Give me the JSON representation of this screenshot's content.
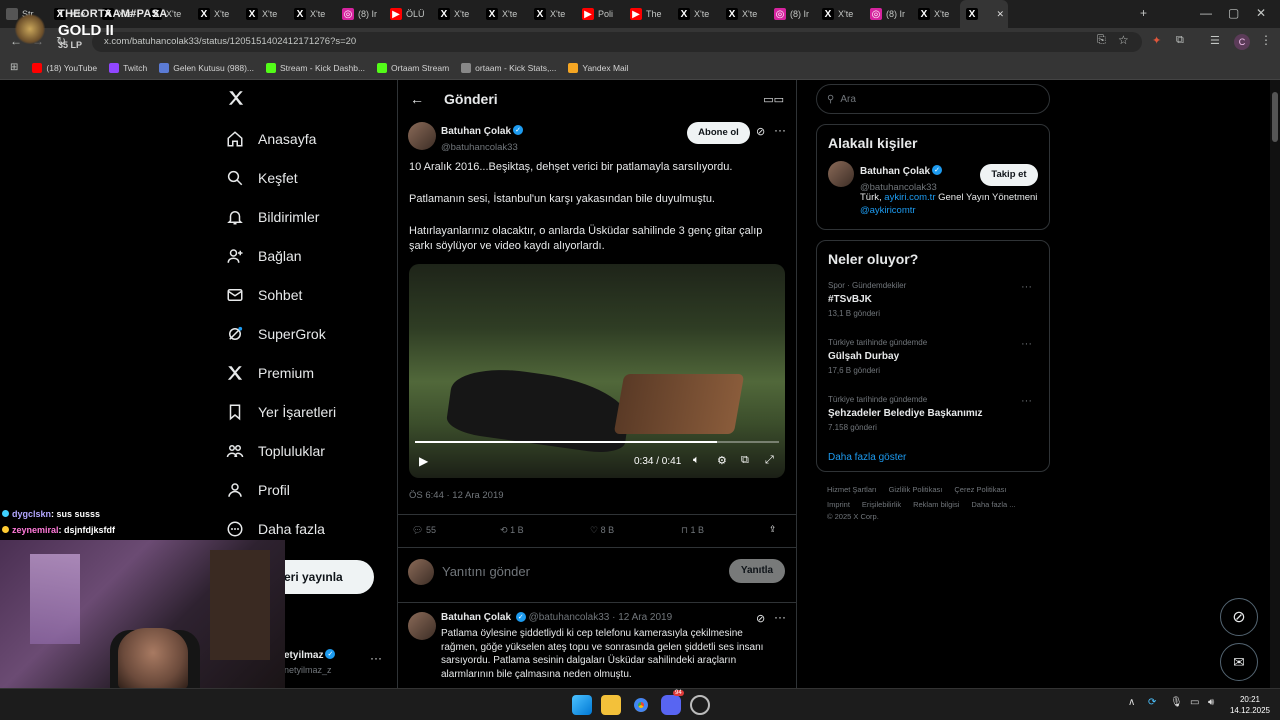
{
  "browser": {
    "tabs": [
      {
        "label": "Str",
        "icon": "blank"
      },
      {
        "label": "X'te",
        "icon": "x"
      },
      {
        "label": "X'te",
        "icon": "x"
      },
      {
        "label": "X'te",
        "icon": "x"
      },
      {
        "label": "X'te",
        "icon": "x"
      },
      {
        "label": "X'te",
        "icon": "x"
      },
      {
        "label": "X'te",
        "icon": "x"
      },
      {
        "label": "(8) Ir",
        "icon": "instagram"
      },
      {
        "label": "ÖLÜ",
        "icon": "youtube"
      },
      {
        "label": "X'te",
        "icon": "x"
      },
      {
        "label": "X'te",
        "icon": "x"
      },
      {
        "label": "X'te",
        "icon": "x"
      },
      {
        "label": "Poli",
        "icon": "youtube"
      },
      {
        "label": "The",
        "icon": "youtube"
      },
      {
        "label": "X'te",
        "icon": "x"
      },
      {
        "label": "X'te",
        "icon": "x"
      },
      {
        "label": "(8) Ir",
        "icon": "instagram"
      },
      {
        "label": "X'te",
        "icon": "x"
      },
      {
        "label": "(8) Ir",
        "icon": "instagram"
      },
      {
        "label": "X'te",
        "icon": "x"
      },
      {
        "label": "",
        "icon": "x"
      }
    ],
    "url": "x.com/batuhancolak33/status/1205151402412171276?s=20",
    "profile_initial": "C",
    "bookmarks": [
      {
        "label": "(18) YouTube",
        "color": "#ff0000"
      },
      {
        "label": "Twitch",
        "color": "#9146ff"
      },
      {
        "label": "Gelen Kutusu (988)...",
        "color": "#5b7bd5"
      },
      {
        "label": "Stream - Kick Dashb...",
        "color": "#53fc18"
      },
      {
        "label": "Ortaam Stream",
        "color": "#53fc18"
      },
      {
        "label": "ortaam - Kick Stats,...",
        "color": "#888888"
      },
      {
        "label": "Yandex Mail",
        "color": "#f5a623"
      }
    ]
  },
  "overlay": {
    "channel": "THEORTAAM#PASA",
    "rank": "GOLD II",
    "lp": "35 LP",
    "chat": [
      {
        "user": "dygclskn",
        "message": ": sus susss",
        "color": "#b3a7ff"
      },
      {
        "user": "zeynemiral",
        "message": ": dsjnfdjksfdf",
        "color": "#ff7ad9"
      }
    ]
  },
  "nav": {
    "items": [
      {
        "label": "Anasayfa",
        "icon": "home"
      },
      {
        "label": "Keşfet",
        "icon": "search"
      },
      {
        "label": "Bildirimler",
        "icon": "bell"
      },
      {
        "label": "Bağlan",
        "icon": "person-add"
      },
      {
        "label": "Sohbet",
        "icon": "mail"
      },
      {
        "label": "SuperGrok",
        "icon": "grok"
      },
      {
        "label": "Premium",
        "icon": "x"
      },
      {
        "label": "Yer İşaretleri",
        "icon": "bookmark"
      },
      {
        "label": "Topluluklar",
        "icon": "people"
      },
      {
        "label": "Profil",
        "icon": "person"
      },
      {
        "label": "Daha fazla",
        "icon": "more"
      }
    ],
    "post_button": "eri yayınla",
    "account_name": "etyilmaz",
    "account_handle": "netyilmaz_z"
  },
  "post": {
    "header_title": "Gönderi",
    "author_name": "Batuhan Çolak",
    "author_handle": "@batuhancolak33",
    "subscribe_label": "Abone ol",
    "paragraphs": [
      "10 Aralık 2016...Beşiktaş, dehşet verici bir patlamayla sarsılıyordu.",
      "Patlamanın sesi, İstanbul'un karşı yakasından bile duyulmuştu.",
      "Hatırlayanlarınız olacaktır, o anlarda Üsküdar sahilinde 3 genç gitar çalıp şarkı söylüyor ve video kaydı alıyorlardı."
    ],
    "video_time": "0:34 / 0:41",
    "video_progress": 0.83,
    "timestamp": "ÖS 6:44 · 12 Ara 2019",
    "stats": {
      "replies": "55",
      "reposts": "1 B",
      "likes": "8 B",
      "bookmarks": "1 B"
    },
    "reply_placeholder": "Yanıtını gönder",
    "reply_button": "Yanıtla"
  },
  "reply": {
    "author_name": "Batuhan Çolak",
    "meta": "@batuhancolak33 · 12 Ara 2019",
    "text": "Patlama öylesine şiddetliydi ki cep telefonu kamerasıyla çekilmesine rağmen, göğe yükselen ateş topu ve sonrasında gelen şiddetli ses insanı sarsıyordu. Patlama sesinin dalgaları Üsküdar sahilindeki araçların alarmlarının bile çalmasına neden olmuştu."
  },
  "sidebar": {
    "search_placeholder": "Ara",
    "relevant_title": "Alakalı kişiler",
    "person": {
      "name": "Batuhan Çolak",
      "handle": "@batuhancolak33",
      "follow_label": "Takip et",
      "bio_prefix": "Türk, ",
      "bio_link1": "aykiri.com.tr",
      "bio_mid": " Genel Yayın Yönetmeni ",
      "bio_link2": "@aykiricomtr"
    },
    "trends_title": "Neler oluyor?",
    "trends": [
      {
        "category": "Spor · Gündemdekiler",
        "name": "#TSvBJK",
        "count": "13,1 B gönderi"
      },
      {
        "category": "Türkiye tarihinde gündemde",
        "name": "Gülşah Durbay",
        "count": "17,6 B gönderi"
      },
      {
        "category": "Türkiye tarihinde gündemde",
        "name": "Şehzadeler Belediye Başkanımız",
        "count": "7.158 gönderi"
      }
    ],
    "show_more": "Daha fazla göster",
    "footer_links": [
      "Hizmet Şartları",
      "Gizlilik Politikası",
      "Çerez Politikası",
      "Imprint",
      "Erişilebilirlik",
      "Reklam bilgisi",
      "Daha fazla ..."
    ],
    "copyright": "© 2025 X Corp."
  },
  "taskbar": {
    "time": "20:21",
    "date": "14.12.2025",
    "discord_badge": "94"
  },
  "colors": {
    "accent": "#1d9bf0",
    "background": "#000000",
    "text": "#e7e9ea",
    "muted": "#71767b"
  }
}
